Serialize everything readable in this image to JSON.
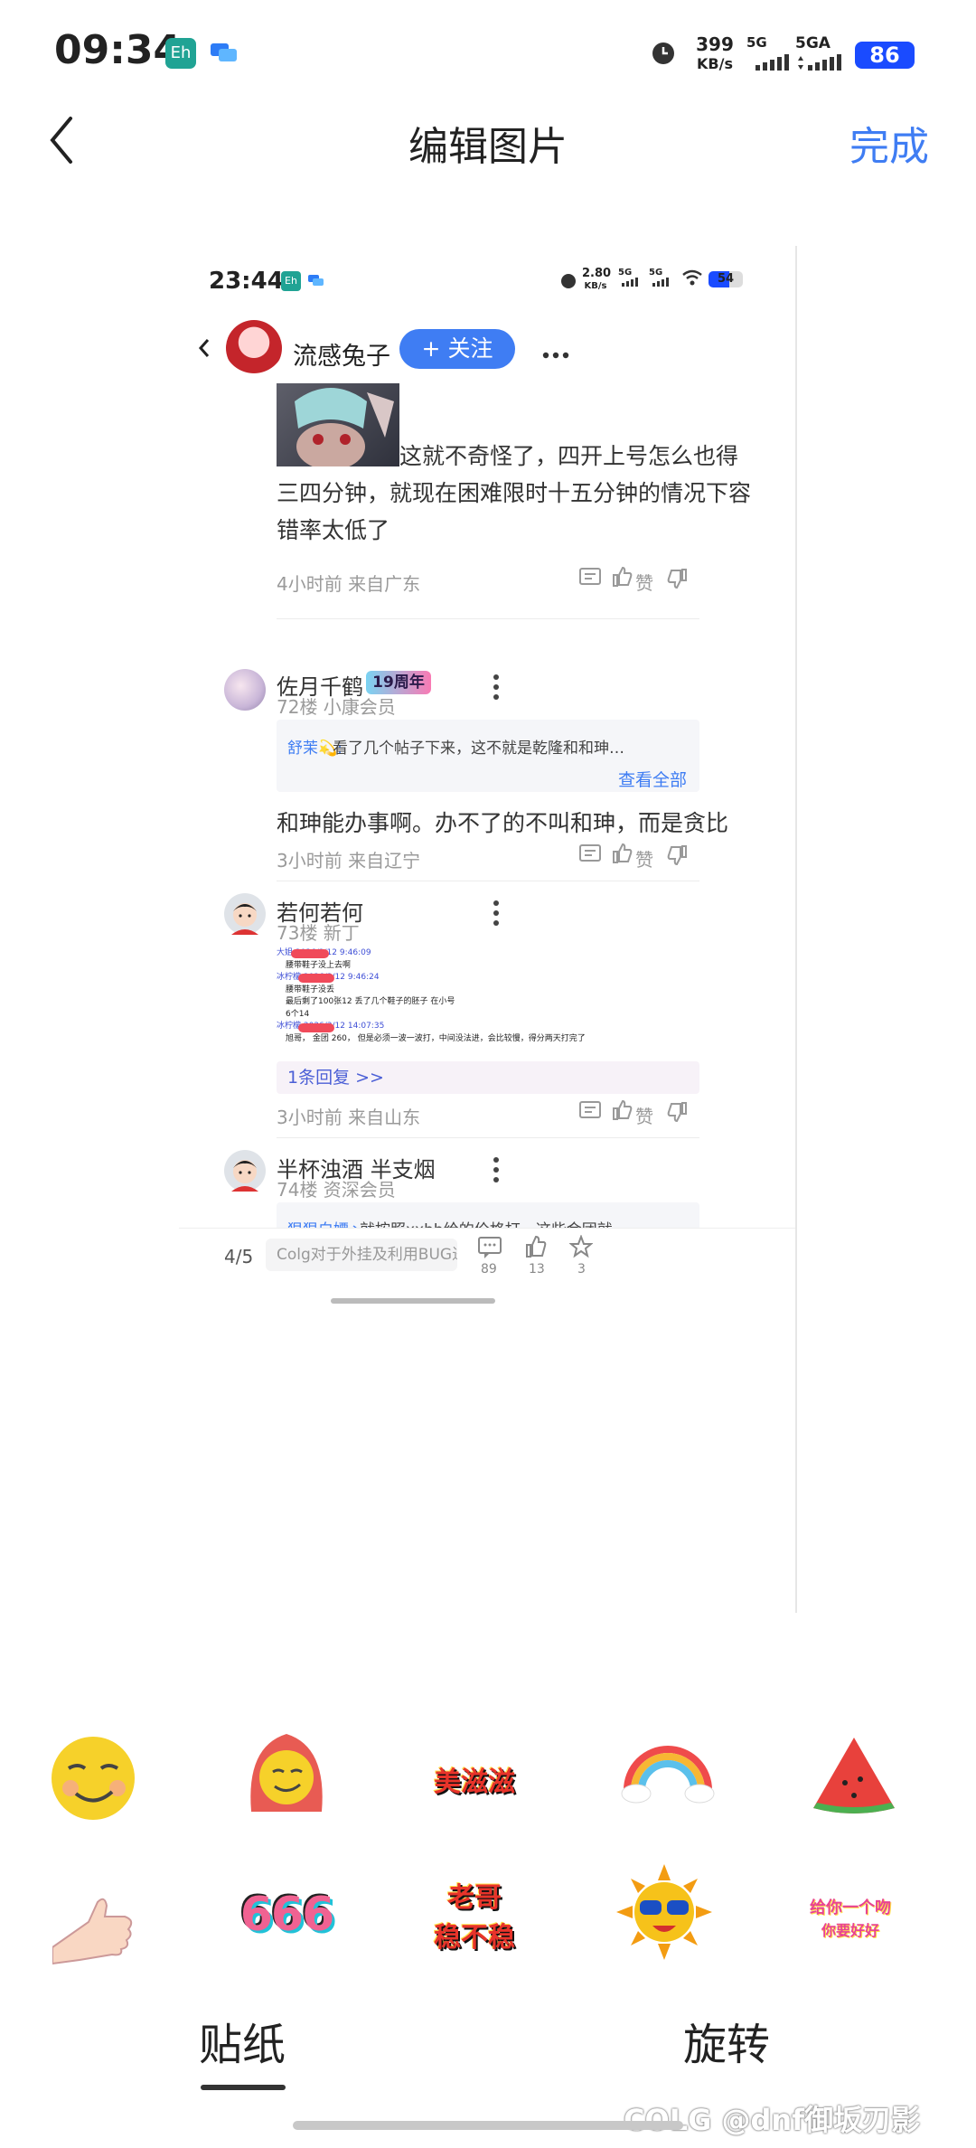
{
  "status_bar": {
    "time": "09:34",
    "net_speed": "399",
    "net_unit": "KB/s",
    "net1": "5G",
    "net2": "5GA",
    "battery": "86"
  },
  "header": {
    "title": "编辑图片",
    "done": "完成"
  },
  "inner": {
    "status": {
      "time": "23:44",
      "net_speed": "2.80",
      "net_unit": "KB/s",
      "net1": "5G",
      "net2": "5G",
      "battery": "54"
    },
    "user": "流感兔子",
    "follow": "+ 关注",
    "post1": {
      "line1": "这就不奇怪了，四开上号怎么也得",
      "line2": "三四分钟，就现在困难限时十五分钟的情况下容",
      "line3": "错率太低了",
      "meta": "4小时前 来自广东",
      "like": "赞"
    },
    "c1": {
      "name": "佐月千鹤",
      "badge": "19周年",
      "floor": "72楼 小康会员",
      "quote_user": "舒茉💫:",
      "quote_text": " 看了几个帖子下来，这不就是乾隆和和珅…",
      "view_all": "查看全部",
      "body": "和珅能办事啊。办不了的不叫和珅，而是贪比",
      "meta": "3小时前 来自辽宁",
      "like": "赞"
    },
    "c2": {
      "name": "若何若何",
      "floor": "73楼 新丁",
      "img_lines": [
        "大姐 2026/3/12 9:46:09",
        "腰带鞋子没上去啊",
        "冰柠檬 2026/3/12 9:46:24",
        "腰带鞋子没丢",
        "最后剩了100张12  丢了几个鞋子的胚子 在小号",
        "6个14",
        "冰柠檬 2026/3/12 14:07:35",
        "旭哥，  金团 260，  但是必须一波一波打，中间没法进，会比较慢，得分两天打完了"
      ],
      "reply": "1条回复 >>",
      "meta": "3小时前 来自山东",
      "like": "赞"
    },
    "c3": {
      "name": "半杯浊酒 半支烟",
      "floor": "74楼 资深会员",
      "quote_user": "狠狠白嫖丶:",
      "quote_text": " 就按照xxbb给的价格打，这些金团就…"
    },
    "bottom": {
      "page": "4/5",
      "input": "Colg对于外挂及利用BUG进…",
      "comments": "89",
      "likes": "13",
      "stars": "3"
    }
  },
  "stickers": {
    "row1_text": "美滋滋",
    "row2_666": "666",
    "row2_laoge1": "老哥",
    "row2_laoge2": "稳不稳",
    "row2_sign1": "给你一个吻",
    "row2_sign2": "你要好好"
  },
  "tabs": {
    "sticker": "贴纸",
    "rotate": "旋转"
  },
  "watermark": "COLG @dnf御坂刃影",
  "colors": {
    "accent": "#3f7df3",
    "battery": "#1a4bff"
  }
}
